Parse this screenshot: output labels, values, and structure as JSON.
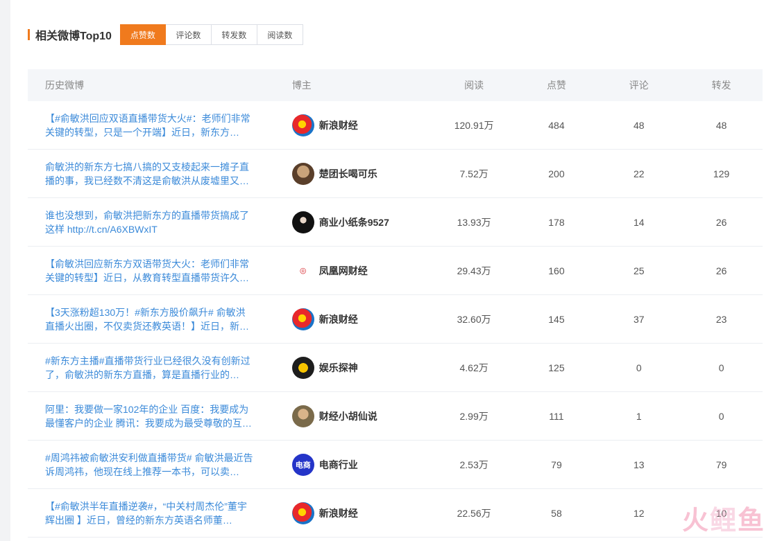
{
  "header": {
    "title": "相关微博Top10"
  },
  "tabs": [
    {
      "label": "点赞数",
      "active": true
    },
    {
      "label": "评论数",
      "active": false
    },
    {
      "label": "转发数",
      "active": false
    },
    {
      "label": "阅读数",
      "active": false
    }
  ],
  "columns": {
    "weibo": "历史微博",
    "blogger": "博主",
    "reads": "阅读",
    "likes": "点赞",
    "comments": "评论",
    "reposts": "转发"
  },
  "rows": [
    {
      "text": "【#俞敏洪回应双语直播带货大火#：老师们非常关键的转型，只是一个开端】近日，新东方…",
      "blogger": "新浪财经",
      "avatar": "sina-eye-icon",
      "reads": "120.91万",
      "likes": "484",
      "comments": "48",
      "reposts": "48"
    },
    {
      "text": "俞敏洪的新东方七搞八搞的又支棱起来一摊子直播的事，我已经数不清这是俞敏洪从废墟里又…",
      "blogger": "楚团长喝可乐",
      "avatar": "monkey-avatar-icon",
      "reads": "7.52万",
      "likes": "200",
      "comments": "22",
      "reposts": "129"
    },
    {
      "text": "谁也没想到，俞敏洪把新东方的直播带货搞成了这样 http://t.cn/A6XBWxIT",
      "blogger": "商业小纸条9527",
      "avatar": "person-avatar-icon",
      "reads": "13.93万",
      "likes": "178",
      "comments": "14",
      "reposts": "26"
    },
    {
      "text": "【俞敏洪回应新东方双语带货大火：老师们非常关键的转型】近日，从教育转型直播带货许久…",
      "blogger": "凤凰网财经",
      "avatar": "ifeng-logo-icon",
      "reads": "29.43万",
      "likes": "160",
      "comments": "25",
      "reposts": "26"
    },
    {
      "text": "【3天涨粉超130万！#新东方股价飙升# 俞敏洪直播火出圈，不仅卖货还教英语！】近日，新…",
      "blogger": "新浪财经",
      "avatar": "sina-eye-icon",
      "reads": "32.60万",
      "likes": "145",
      "comments": "37",
      "reposts": "23"
    },
    {
      "text": "#新东方主播#直播带货行业已经很久没有创新过了，俞敏洪的新东方直播，算是直播行业的…",
      "blogger": "娱乐探神",
      "avatar": "entertainment-logo-icon",
      "reads": "4.62万",
      "likes": "125",
      "comments": "0",
      "reposts": "0"
    },
    {
      "text": "阿里：我要做一家102年的企业 百度：我要成为最懂客户的企业 腾讯：我要成为最受尊敬的互…",
      "blogger": "财经小胡仙说",
      "avatar": "woman-avatar-icon",
      "reads": "2.99万",
      "likes": "111",
      "comments": "1",
      "reposts": "0"
    },
    {
      "text": "#周鸿祎被俞敏洪安利做直播带货# 俞敏洪最近告诉周鸿祎，他现在线上推荐一本书，可以卖…",
      "blogger": "电商行业",
      "avatar": "ecommerce-logo-icon",
      "reads": "2.53万",
      "likes": "79",
      "comments": "13",
      "reposts": "79"
    },
    {
      "text": "【#俞敏洪半年直播逆袭#，“中关村周杰伦”董宇辉出圈 】近日，曾经的新东方英语名师董…",
      "blogger": "新浪财经",
      "avatar": "sina-eye-icon",
      "reads": "22.56万",
      "likes": "58",
      "comments": "12",
      "reposts": "10"
    }
  ],
  "watermark": {
    "part1": "火",
    "part2": "鲤",
    "part3": "鱼"
  },
  "colors": {
    "accent": "#f07a1d",
    "link": "#3b8ad9"
  }
}
